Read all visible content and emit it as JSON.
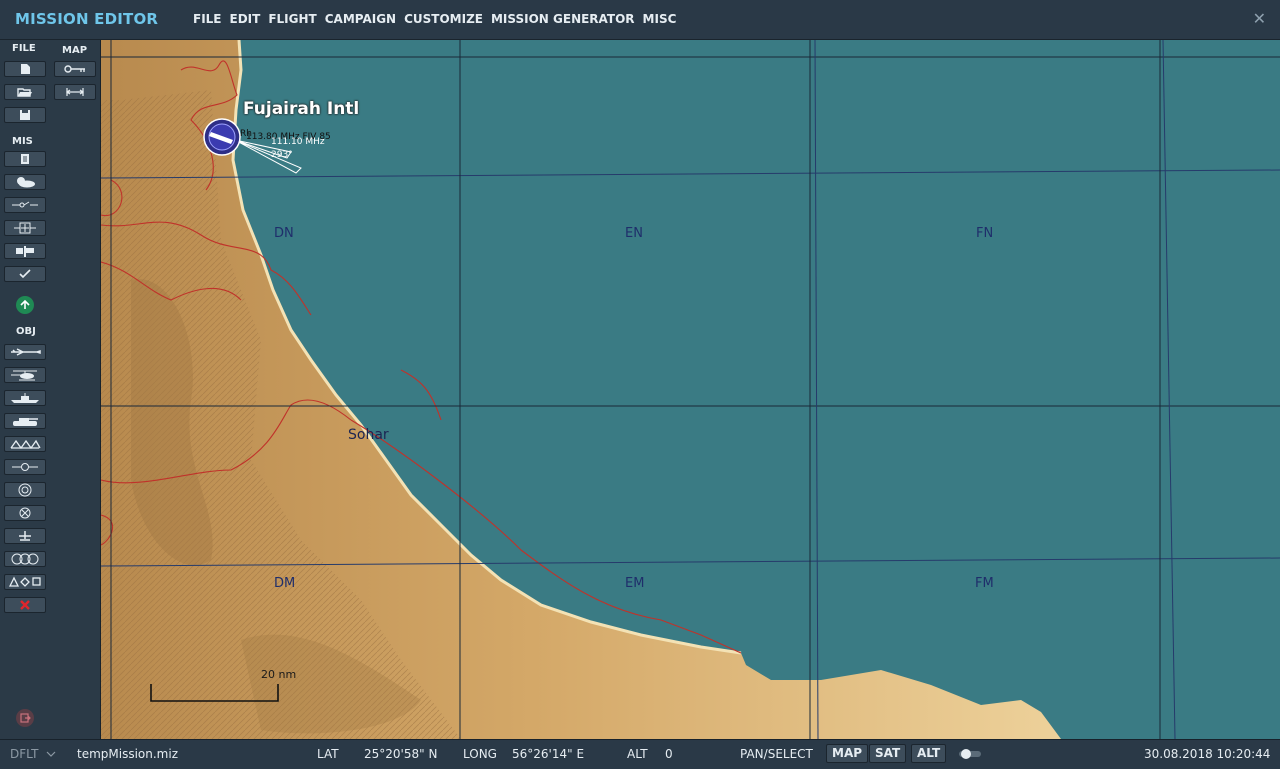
{
  "app": {
    "title": "MISSION EDITOR",
    "close_symbol": "✕"
  },
  "menu": [
    "FILE",
    "EDIT",
    "FLIGHT",
    "CAMPAIGN",
    "CUSTOMIZE",
    "MISSION GENERATOR",
    "MISC"
  ],
  "toolbar": {
    "file_label": "FILE",
    "map_label": "MAP",
    "mis_label": "MIS",
    "obj_label": "OBJ",
    "file_buttons": [
      "new-file-icon",
      "open-folder-icon",
      "save-disk-icon"
    ],
    "map_buttons": [
      "ruler-icon",
      "distance-measure-icon"
    ],
    "mis_buttons": [
      "briefing-icon",
      "weather-icon",
      "triggers-icon",
      "zones-icon",
      "goals-icon",
      "check-icon"
    ],
    "up_button": "arrow-up-circle-icon",
    "obj_buttons": [
      "airplane-icon",
      "helicopter-icon",
      "ship-icon",
      "tank-icon",
      "static-object-icon",
      "template-icon",
      "navpoint-icon",
      "target-icon",
      "initial-point-icon",
      "bullseye-icon",
      "shapes-icon",
      "delete-icon"
    ],
    "exit_button": "exit-icon"
  },
  "map": {
    "airport_name": "Fujairah Intl",
    "airport_freq": "113.80 MHz FJV 85",
    "ils_freq": "111.10 MHz",
    "runway_heading": "293°",
    "airport_code_fragment": "Rh",
    "city": "Sohar",
    "grid_labels": [
      "DN",
      "EN",
      "FN",
      "DM",
      "EM",
      "FM"
    ],
    "scale_label": "20 nm",
    "colors": {
      "sea": "#3a7b84",
      "land": "#e8c58a",
      "border": "#c0322a",
      "grid": "#1f2e6b"
    }
  },
  "status": {
    "profile": "DFLT",
    "filename": "tempMission.miz",
    "lat_label": "LAT",
    "lat_value": "25°20'58\" N",
    "long_label": "LONG",
    "long_value": "56°26'14\" E",
    "alt_label": "ALT",
    "alt_value": "0",
    "mode": "PAN/SELECT",
    "btn_map": "MAP",
    "btn_sat": "SAT",
    "btn_alt": "ALT",
    "datetime": "30.08.2018 10:20:44"
  }
}
